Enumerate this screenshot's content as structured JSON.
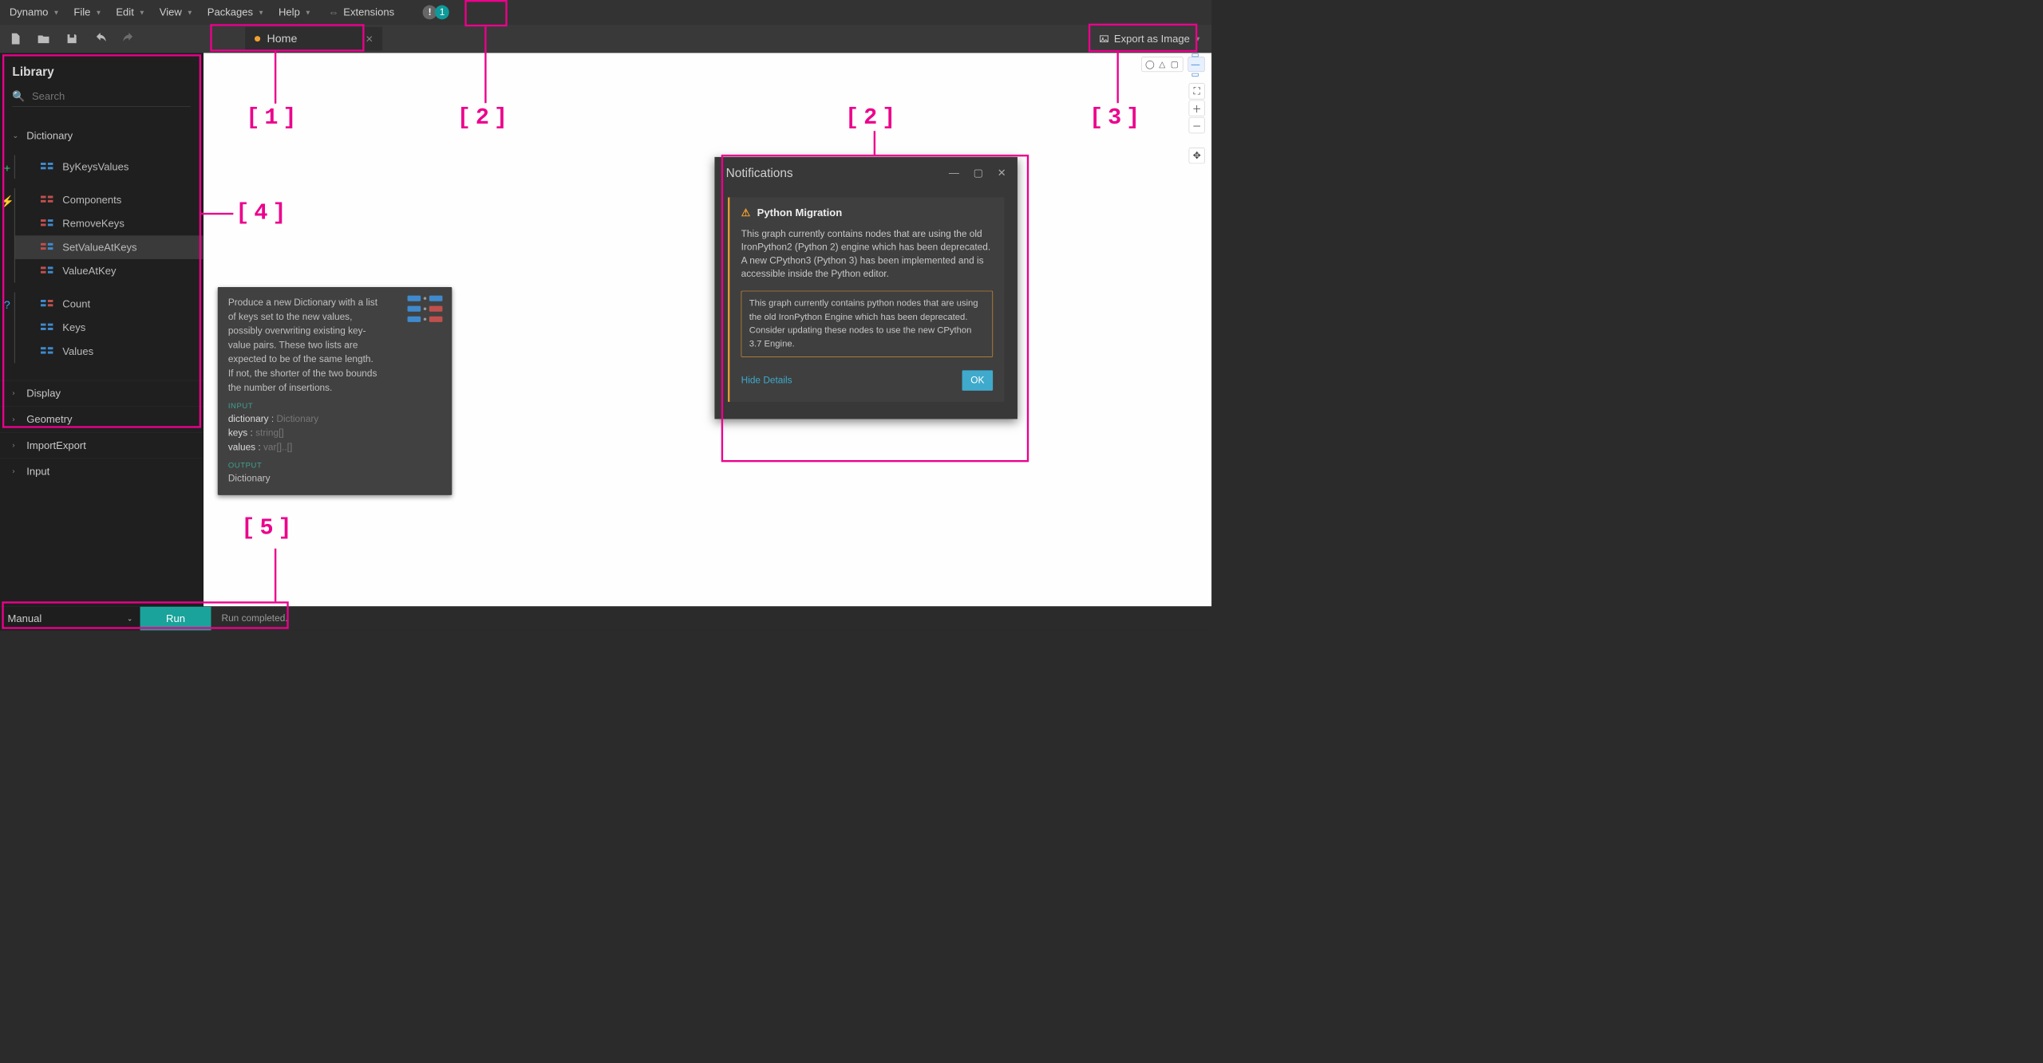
{
  "menus": [
    "Dynamo",
    "File",
    "Edit",
    "View",
    "Packages",
    "Help"
  ],
  "extensions_label": "Extensions",
  "notif_count": "1",
  "tab": {
    "title": "Home"
  },
  "export_label": "Export as Image",
  "sidebar": {
    "title": "Library",
    "search_placeholder": "Search",
    "open_category": "Dictionary",
    "nodes_create": [
      "ByKeysValues"
    ],
    "nodes_action": [
      "Components",
      "RemoveKeys",
      "SetValueAtKeys",
      "ValueAtKey"
    ],
    "selected_action": "SetValueAtKeys",
    "nodes_query": [
      "Count",
      "Keys",
      "Values"
    ],
    "collapsed": [
      "Display",
      "Geometry",
      "ImportExport",
      "Input"
    ]
  },
  "tooltip": {
    "desc": "Produce a new Dictionary with a list of keys set to the new values, possibly overwriting existing key-value pairs. These two lists are expected to be of the same length. If not, the shorter of the two bounds the number of insertions.",
    "input_label": "INPUT",
    "inputs": [
      {
        "name": "dictionary",
        "type": "Dictionary"
      },
      {
        "name": "keys",
        "type": "string[]"
      },
      {
        "name": "values",
        "type": "var[]..[]"
      }
    ],
    "output_label": "OUTPUT",
    "output": "Dictionary"
  },
  "notifications": {
    "title": "Notifications",
    "card_title": "Python Migration",
    "text": "This graph currently contains nodes that are using the old IronPython2 (Python 2) engine which has been deprecated. A new CPython3 (Python 3) has been implemented and is accessible inside the Python editor.",
    "detail": "This graph currently contains python nodes that are using the old IronPython Engine which has been deprecated. Consider updating these nodes to use the new CPython 3.7 Engine.",
    "hide": "Hide Details",
    "ok": "OK"
  },
  "footer": {
    "mode": "Manual",
    "run": "Run",
    "status": "Run completed."
  },
  "callouts": {
    "c1": "[1]",
    "c2": "[2]",
    "c2b": "[2]",
    "c3": "[3]",
    "c4": "[4]",
    "c5": "[5]"
  }
}
